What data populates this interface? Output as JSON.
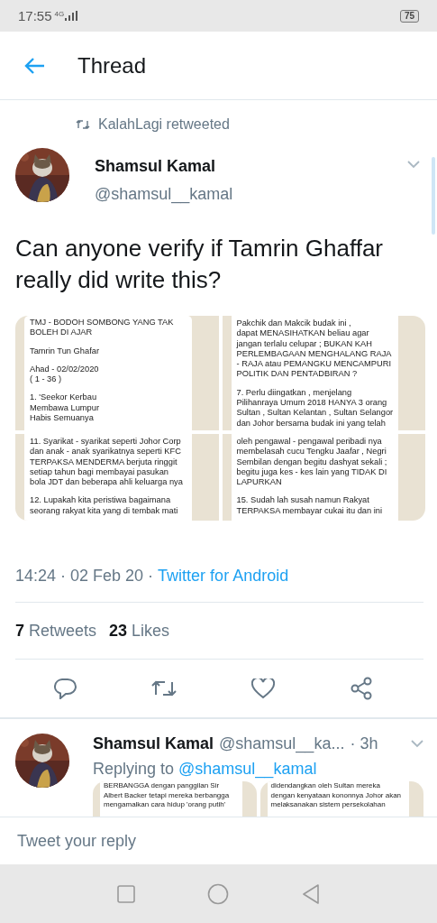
{
  "status_bar": {
    "time": "17:55",
    "network": "4G",
    "battery": "75"
  },
  "header": {
    "title": "Thread"
  },
  "tweet": {
    "retweeted_by": "KalahLagi retweeted",
    "author": {
      "name": "Shamsul Kamal",
      "handle": "@shamsul__kamal"
    },
    "text": "Can anyone verify if Tamrin Ghaffar really did write this?",
    "images": [
      {
        "paragraphs": [
          [
            "TMJ - BODOH SOMBONG YANG TAK",
            "BOLEH DI AJAR"
          ],
          [
            "Tamrin Tun Ghafar"
          ],
          [
            "Ahad - 02/02/2020",
            "( 1 - 36 )"
          ],
          [
            "1. 'Seekor Kerbau",
            "Membawa Lumpur",
            "Habis Semuanya"
          ]
        ]
      },
      {
        "paragraphs": [
          [
            "Pakchik dan Makcik budak ini ,",
            "dapat MENASIHATKAN beliau agar",
            "jangan terlalu celupar ; BUKAN KAH",
            "PERLEMBAGAAN MENGHALANG RAJA",
            "- RAJA atau PEMANGKU MENCAMPURI",
            "POLITIK DAN PENTADBIRAN ?"
          ],
          [
            "7. Perlu diingatkan , menjelang",
            "Pilihanraya Umum 2018 HANYA 3 orang",
            "Sultan , Sultan Kelantan , Sultan Selangor",
            "dan Johor bersama budak ini yang telah"
          ]
        ]
      },
      {
        "paragraphs": [
          [
            "11. Syarikat - syarikat seperti Johor Corp",
            "dan anak - anak syarikatnya seperti KFC",
            "TERPAKSA MENDERMA berjuta ringgit",
            "setiap tahun bagi membayai pasukan",
            "bola JDT dan beberapa ahli keluarga nya"
          ],
          [
            "12. Lupakah kita peristiwa bagaimana",
            "seorang rakyat kita yang di tembak mati"
          ]
        ]
      },
      {
        "paragraphs": [
          [
            "oleh pengawal - pengawal peribadi nya",
            "membelasah cucu Tengku Jaafar , Negri",
            "Sembilan dengan begitu dashyat sekali ;",
            "begitu juga kes - kes lain yang TIDAK DI",
            "LAPURKAN"
          ],
          [
            "15. Sudah lah susah namun Rakyat",
            "TERPAKSA membayar cukai itu dan ini"
          ]
        ]
      }
    ],
    "timestamp": "14:24 · 02 Feb 20 · ",
    "source": "Twitter for Android",
    "stats": [
      {
        "count": "7",
        "label": "Retweets"
      },
      {
        "count": "23",
        "label": "Likes"
      }
    ]
  },
  "reply": {
    "author": {
      "name": "Shamsul Kamal",
      "handle": "@shamsul__ka..."
    },
    "time": "· 3h",
    "replying_prefix": "Replying to",
    "replying_to": "@shamsul__kamal",
    "images": [
      {
        "paragraphs": [
          [
            "BERBANGGA dengan panggilan Sir",
            "Albert Backer tetapi mereka berbangga",
            "mengamalkan cara hidup 'orang putih'"
          ]
        ]
      },
      {
        "paragraphs": [
          [
            "didendangkan oleh Sultan mereka",
            "dengan kenyataan kononnya Johor akan",
            "melaksanakan sistem persekolahan"
          ]
        ]
      }
    ]
  },
  "compose": {
    "placeholder": "Tweet your reply"
  }
}
